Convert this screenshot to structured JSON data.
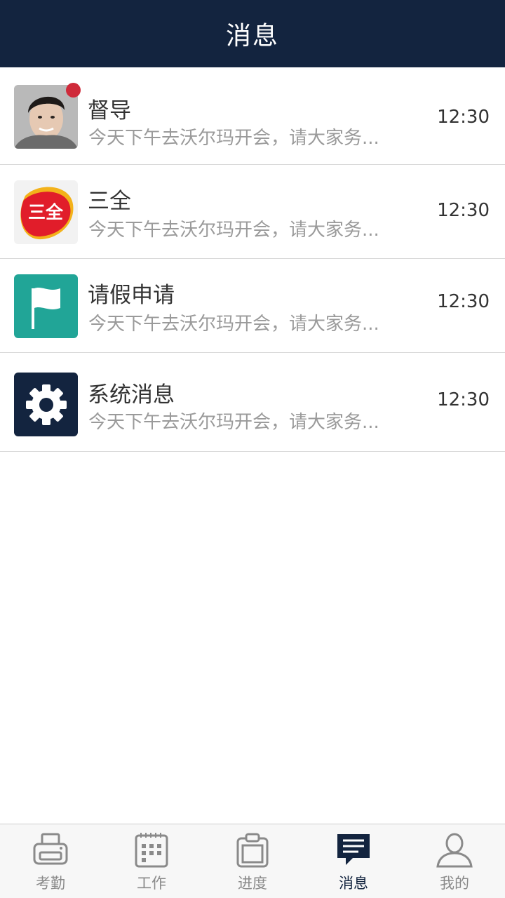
{
  "header": {
    "title": "消息"
  },
  "messages": [
    {
      "name": "督导",
      "preview": "今天下午去沃尔玛开会，请大家务...",
      "time": "12:30",
      "icon": "person-photo-icon",
      "unread": true
    },
    {
      "name": "三全",
      "preview": "今天下午去沃尔玛开会，请大家务...",
      "time": "12:30",
      "icon": "sanquan-logo-icon",
      "logo_text": "三全",
      "unread": false
    },
    {
      "name": "请假申请",
      "preview": "今天下午去沃尔玛开会，请大家务...",
      "time": "12:30",
      "icon": "flag-icon",
      "unread": false
    },
    {
      "name": "系统消息",
      "preview": "今天下午去沃尔玛开会，请大家务...",
      "time": "12:30",
      "icon": "gear-icon",
      "unread": false
    }
  ],
  "tabs": [
    {
      "label": "考勤",
      "icon": "printer-icon",
      "active": false
    },
    {
      "label": "工作",
      "icon": "calendar-icon",
      "active": false
    },
    {
      "label": "进度",
      "icon": "clipboard-icon",
      "active": false
    },
    {
      "label": "消息",
      "icon": "message-icon",
      "active": true
    },
    {
      "label": "我的",
      "icon": "user-icon",
      "active": false
    }
  ],
  "colors": {
    "header_bg": "#13243f",
    "badge": "#cf2a3a",
    "flag_bg": "#21a597",
    "gear_bg": "#13243f",
    "tab_inactive": "#8a8a8a",
    "tab_active": "#13243f"
  }
}
